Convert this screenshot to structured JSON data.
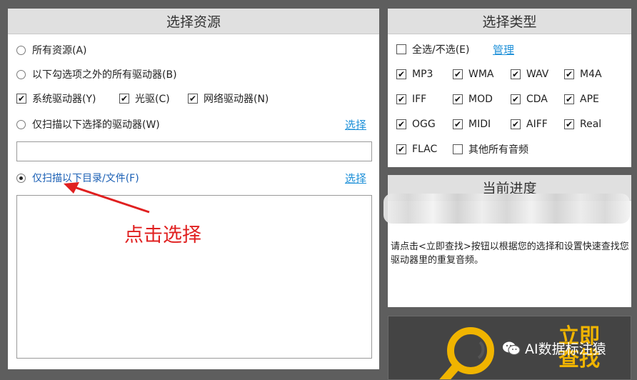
{
  "source_panel": {
    "title": "选择资源",
    "options": {
      "all_resources": "所有资源(A)",
      "all_drives_except": "以下勾选项之外的所有驱动器(B)",
      "system_drives": "系统驱动器(Y)",
      "optical_drives": "光驱(C)",
      "network_drives": "网络驱动器(N)",
      "selected_drives_only": "仅扫描以下选择的驱动器(W)",
      "dirs_files_only": "仅扫描以下目录/文件(F)"
    },
    "select_link_1": "选择",
    "select_link_2": "选择",
    "drives_input_value": "",
    "annotation": "点击选择"
  },
  "type_panel": {
    "title": "选择类型",
    "select_all_label": "全选/不选(E)",
    "manage_link": "管理",
    "formats": [
      {
        "label": "MP3",
        "checked": true
      },
      {
        "label": "WMA",
        "checked": true
      },
      {
        "label": "WAV",
        "checked": true
      },
      {
        "label": "M4A",
        "checked": true
      },
      {
        "label": "IFF",
        "checked": true
      },
      {
        "label": "MOD",
        "checked": true
      },
      {
        "label": "CDA",
        "checked": true
      },
      {
        "label": "APE",
        "checked": true
      },
      {
        "label": "OGG",
        "checked": true
      },
      {
        "label": "MIDI",
        "checked": true
      },
      {
        "label": "AIFF",
        "checked": true
      },
      {
        "label": "Real",
        "checked": true
      },
      {
        "label": "FLAC",
        "checked": true
      },
      {
        "label": "其他所有音频",
        "checked": false
      }
    ]
  },
  "progress_panel": {
    "title": "当前进度",
    "message": "请点击<立即查找>按钮以根据您的选择和设置快速查找您驱动器里的重复音频。"
  },
  "start_button": {
    "line1": "立即",
    "line2": "查找"
  },
  "watermark": "AI数据标注猿",
  "colors": {
    "accent_link": "#1e90d8",
    "annotation_red": "#e02020",
    "start_yellow": "#f0b400"
  }
}
